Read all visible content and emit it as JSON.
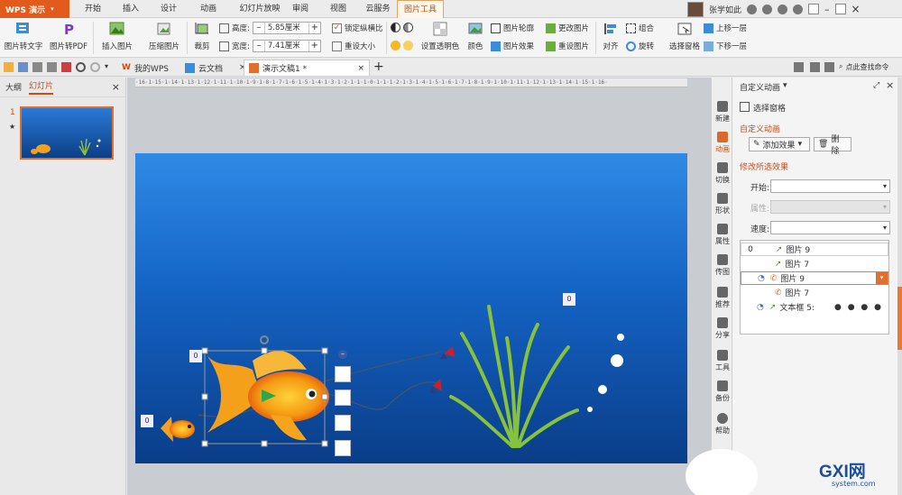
{
  "app": {
    "menu_label": "WPS 演示"
  },
  "ribbon_tabs": [
    "开始",
    "插入",
    "设计",
    "动画",
    "幻灯片放映",
    "审阅",
    "视图",
    "云服务",
    "图片工具"
  ],
  "user": {
    "name": "张学如此"
  },
  "ribbon": {
    "pic_to_text": "图片转文字",
    "pic_to_pdf": "图片转PDF",
    "insert_pic": "插入图片",
    "compress_pic": "压缩图片",
    "crop": "裁剪",
    "height_label": "高度:",
    "height_value": "5.85厘米",
    "width_label": "宽度:",
    "width_value": "7.41厘米",
    "lock_ratio": "锁定纵横比",
    "reset_size": "重设大小",
    "set_transparent": "设置透明色",
    "color": "颜色",
    "pic_outline": "图片轮廓",
    "pic_effect": "图片效果",
    "change_pic": "更改图片",
    "reset_pic": "重设图片",
    "align": "对齐",
    "group": "组合",
    "rotate": "旋转",
    "select_pane": "选择窗格",
    "bring_forward": "上移一层",
    "send_backward": "下移一层"
  },
  "doc_tabs": {
    "my_wps": "我的WPS",
    "cloud_doc": "云文档",
    "current": "演示文稿1 *",
    "search": "点此查找命令"
  },
  "left_panel": {
    "outline_tab": "大纲",
    "slides_tab": "幻灯片",
    "slide_number": "1"
  },
  "ruler_text": "·16·1·15·1·14·1·13·1·12·1·11·1·10·1·9·1·8·1·7·1·6·1·5·1·4·1·3·1·2·1·1·1·0·1·1·1·2·1·3·1·4·1·5·1·6·1·7·1·8·1·9·1·10·1·11·1·12·1·13·1·14·1·15·1·16·",
  "slide": {
    "tag_fish_main": "0",
    "tag_fish_small": "0",
    "tag_grass": "0"
  },
  "side_icons": [
    "新建",
    "动画",
    "切换",
    "形状",
    "属性",
    "传图",
    "推荐",
    "分享",
    "工具",
    "备份",
    "帮助"
  ],
  "right_panel": {
    "title": "自定义动画",
    "select_pane": "选择窗格",
    "section_custom": "自定义动画",
    "add_effect": "添加效果",
    "delete": "删除",
    "section_modify": "修改所选效果",
    "start_label": "开始:",
    "property_label": "属性:",
    "speed_label": "速度:",
    "anim_items": [
      {
        "num": "0",
        "name": "图片 9"
      },
      {
        "num": "",
        "name": "图片 7"
      },
      {
        "num": "",
        "name": "图片 9"
      },
      {
        "num": "",
        "name": "图片 7"
      },
      {
        "num": "",
        "name": "文本框 5:",
        "extra": "● ● ● ●"
      }
    ]
  },
  "watermark": {
    "text": "GXI网",
    "sub": "system.com"
  }
}
